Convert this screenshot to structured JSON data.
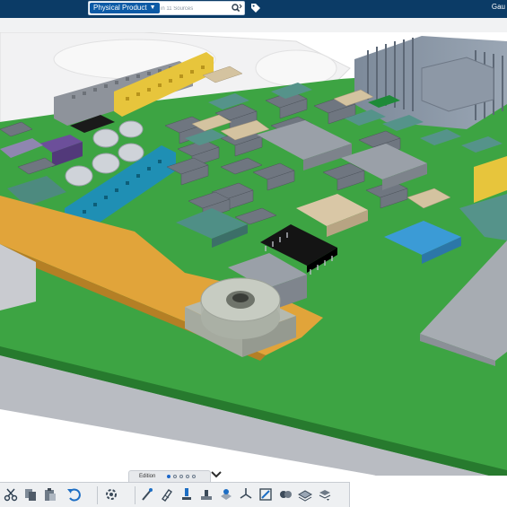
{
  "search": {
    "scope_label": "Physical Product",
    "placeholder": "in 11 Sources"
  },
  "user": {
    "name": "Gau"
  },
  "edition": {
    "label": "Edition",
    "pages": 5,
    "active_page": 1
  },
  "toolbar": {
    "tools": [
      "cut-icon",
      "copy-icon",
      "paste-icon",
      "undo-icon",
      "assembly-icon",
      "probe-icon",
      "pin-icon",
      "part-drop-icon",
      "deposit-icon",
      "sweep-icon",
      "axis-icon",
      "sketch-icon",
      "motor-icon",
      "layer-icon",
      "more-icon"
    ]
  },
  "colors": {
    "topbar": "#0b3b66",
    "pcb": "#3da443",
    "pcb_edge": "#277a2e",
    "copper_strip": "#e1a43a",
    "connector_blue": "#1f8fb4",
    "connector_yellow": "#e7c53c",
    "chip_blue": "#3b9bd6",
    "chip_black": "#141414"
  }
}
